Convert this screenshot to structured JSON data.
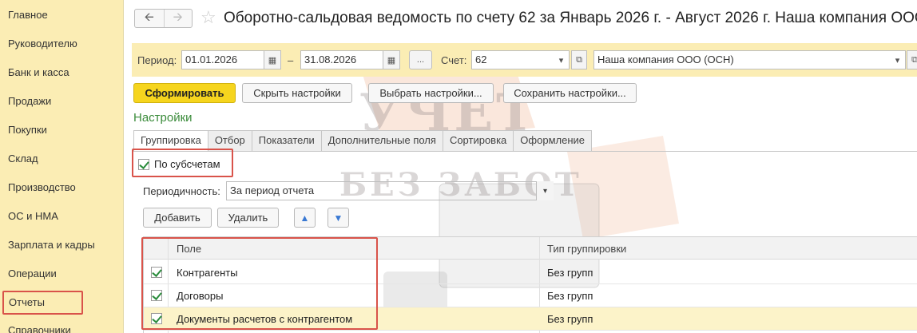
{
  "sidebar": {
    "items": [
      {
        "label": "Главное"
      },
      {
        "label": "Руководителю"
      },
      {
        "label": "Банк и касса"
      },
      {
        "label": "Продажи"
      },
      {
        "label": "Покупки"
      },
      {
        "label": "Склад"
      },
      {
        "label": "Производство"
      },
      {
        "label": "ОС и НМА"
      },
      {
        "label": "Зарплата и кадры"
      },
      {
        "label": "Операции"
      },
      {
        "label": "Отчеты"
      },
      {
        "label": "Справочники"
      }
    ]
  },
  "header": {
    "title": "Оборотно-сальдовая ведомость по счету 62 за Январь 2026 г. - Август 2026 г. Наша компания ООО"
  },
  "params": {
    "period_label": "Период:",
    "date_from": "01.01.2026",
    "dash": "–",
    "date_to": "31.08.2026",
    "ellipsis": "...",
    "account_label": "Счет:",
    "account_value": "62",
    "organization_value": "Наша компания ООО (ОСН)"
  },
  "toolbar": {
    "generate": "Сформировать",
    "hide_settings": "Скрыть настройки",
    "choose_settings": "Выбрать настройки...",
    "save_settings": "Сохранить настройки..."
  },
  "settings": {
    "title": "Настройки",
    "tabs": [
      {
        "label": "Группировка"
      },
      {
        "label": "Отбор"
      },
      {
        "label": "Показатели"
      },
      {
        "label": "Дополнительные поля"
      },
      {
        "label": "Сортировка"
      },
      {
        "label": "Оформление"
      }
    ],
    "by_subaccounts": "По субсчетам",
    "periodicity_label": "Периодичность:",
    "periodicity_value": "За период отчета",
    "add_button": "Добавить",
    "delete_button": "Удалить"
  },
  "grouping_table": {
    "columns": [
      "Поле",
      "Тип группировки"
    ],
    "rows": [
      {
        "field": "Контрагенты",
        "type": "Без групп",
        "checked": true
      },
      {
        "field": "Договоры",
        "type": "Без групп",
        "checked": true
      },
      {
        "field": "Документы расчетов с контрагентом",
        "type": "Без групп",
        "checked": true
      }
    ]
  },
  "watermark": {
    "line1": "УЧЕТ",
    "line2": "БЕЗ ЗАБОТ"
  },
  "colors": {
    "sidebar_bg": "#fbedb4",
    "primary_button": "#f6d51e",
    "highlight_red": "#d9534a",
    "section_green": "#3a8b3a"
  }
}
